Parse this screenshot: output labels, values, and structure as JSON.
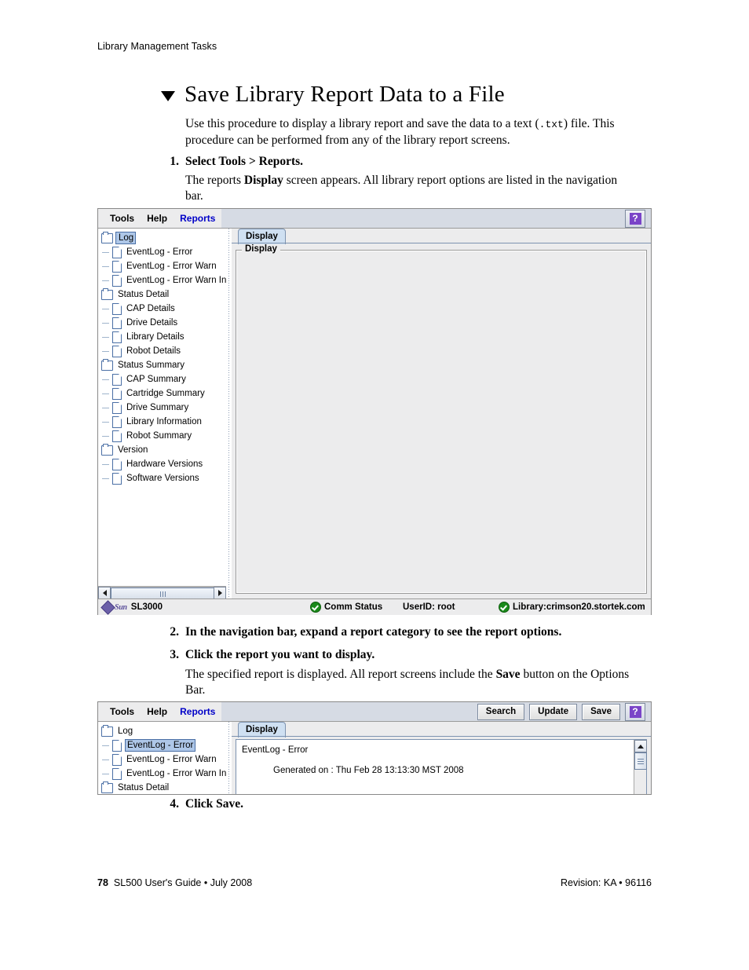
{
  "page": {
    "running_head": "Library Management Tasks",
    "title": "Save Library Report Data to a File",
    "intro_a": "Use this procedure to display a library report and save the data to a text (",
    "intro_mono": ".txt",
    "intro_b": ") file. This procedure can be performed from any of the library report screens.",
    "footer": {
      "page_number": "78",
      "guide": "SL500 User's Guide  •  July 2008",
      "revision": "Revision: KA  •  96116"
    }
  },
  "steps": [
    {
      "num": "1.",
      "label": "Select Tools > Reports.",
      "body_a": "The reports ",
      "body_bold": "Display",
      "body_b": " screen appears. All library report options are listed in the navigation bar."
    },
    {
      "num": "2.",
      "label": "In the navigation bar, expand a report category to see the report options."
    },
    {
      "num": "3.",
      "label": "Click the report you want to display.",
      "body_a": "The specified report is displayed. All report screens include the ",
      "body_bold": "Save",
      "body_b": " button on the Options Bar."
    },
    {
      "num": "4.",
      "label": "Click Save."
    }
  ],
  "screenshot1": {
    "menubar": {
      "items": [
        {
          "label": "Tools",
          "active": false
        },
        {
          "label": "Help",
          "active": false
        },
        {
          "label": "Reports",
          "active": true
        }
      ],
      "help_label": "?"
    },
    "tree": [
      {
        "label": "Log",
        "type": "folder",
        "selected": true
      },
      {
        "label": "EventLog - Error",
        "type": "leaf",
        "selected": false
      },
      {
        "label": "EventLog - Error Warn",
        "type": "leaf",
        "selected": false
      },
      {
        "label": "EventLog - Error Warn Inf",
        "type": "leaf",
        "selected": false
      },
      {
        "label": "Status Detail",
        "type": "folder",
        "selected": false
      },
      {
        "label": "CAP Details",
        "type": "leaf",
        "selected": false
      },
      {
        "label": "Drive Details",
        "type": "leaf",
        "selected": false
      },
      {
        "label": "Library Details",
        "type": "leaf",
        "selected": false
      },
      {
        "label": "Robot Details",
        "type": "leaf",
        "selected": false
      },
      {
        "label": "Status Summary",
        "type": "folder",
        "selected": false
      },
      {
        "label": "CAP Summary",
        "type": "leaf",
        "selected": false
      },
      {
        "label": "Cartridge Summary",
        "type": "leaf",
        "selected": false
      },
      {
        "label": "Drive Summary",
        "type": "leaf",
        "selected": false
      },
      {
        "label": "Library Information",
        "type": "leaf",
        "selected": false
      },
      {
        "label": "Robot Summary",
        "type": "leaf",
        "selected": false
      },
      {
        "label": "Version",
        "type": "folder",
        "selected": false
      },
      {
        "label": "Hardware Versions",
        "type": "leaf",
        "selected": false
      },
      {
        "label": "Software Versions",
        "type": "leaf",
        "selected": false
      }
    ],
    "tab_label": "Display",
    "groupbox_legend": "Display",
    "statusbar": {
      "product": "SL3000",
      "sun_word": "Sun",
      "comm_status": "Comm Status",
      "user_id": "UserID: root",
      "library": "Library:crimson20.stortek.com"
    }
  },
  "screenshot2": {
    "menubar": {
      "items": [
        {
          "label": "Tools",
          "active": false
        },
        {
          "label": "Help",
          "active": false
        },
        {
          "label": "Reports",
          "active": true
        }
      ],
      "buttons": [
        "Search",
        "Update",
        "Save"
      ],
      "help_label": "?"
    },
    "tree": [
      {
        "label": "Log",
        "type": "folder",
        "selected": false
      },
      {
        "label": "EventLog - Error",
        "type": "leaf",
        "selected": true
      },
      {
        "label": "EventLog - Error Warn",
        "type": "leaf",
        "selected": false
      },
      {
        "label": "EventLog - Error Warn Inf",
        "type": "leaf",
        "selected": false
      },
      {
        "label": "Status Detail",
        "type": "folder",
        "selected": false
      }
    ],
    "tab_label": "Display",
    "report": {
      "heading": "EventLog - Error",
      "generated": "Generated on :  Thu Feb 28 13:13:30 MST 2008"
    }
  },
  "colors": {
    "accent_blue": "#0000c8",
    "help_purple": "#7a44c8",
    "status_green": "#1a8a1a",
    "tab_blue": "#cfe0f2",
    "selection_blue": "#aec7e8"
  }
}
